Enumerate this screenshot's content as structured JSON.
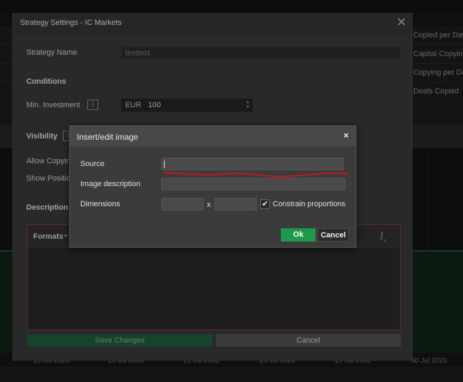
{
  "background": {
    "stats": [
      "Copied per Day",
      "Capital Copying",
      "Copying per Day",
      "Deals Copied"
    ],
    "dates": [
      "15 Jul 2020",
      "16 Jul 2020",
      "21 Jul 2020",
      "24 Jul 2020",
      "27 Jul 2020",
      "30 Jul 2020"
    ]
  },
  "settings": {
    "title": "Strategy Settings - IC Markets",
    "strategy_name_label": "Strategy Name",
    "strategy_name_value": "testtest",
    "conditions_heading": "Conditions",
    "min_investment_label": "Min. Investment",
    "currency": "EUR",
    "min_investment_value": "100",
    "visibility_heading": "Visibility",
    "allow_copying_label": "Allow Copyin",
    "show_positions_label": "Show Positio",
    "description_heading": "Description",
    "formats_label": "Formats",
    "save_label": "Save Changes",
    "cancel_label": "Cancel"
  },
  "modal": {
    "title": "Insert/edit image",
    "close_symbol": "×",
    "source_label": "Source",
    "source_value": "",
    "description_label": "Image description",
    "description_value": "",
    "dimensions_label": "Dimensions",
    "width_value": "",
    "height_value": "",
    "separator": "x",
    "constrain_label": "Constrain proportions",
    "constrain_checked": true,
    "ok_label": "Ok",
    "cancel_label": "Cancel"
  },
  "colors": {
    "accent_green": "#1e9a4c",
    "annotation_red": "#c0181c"
  }
}
